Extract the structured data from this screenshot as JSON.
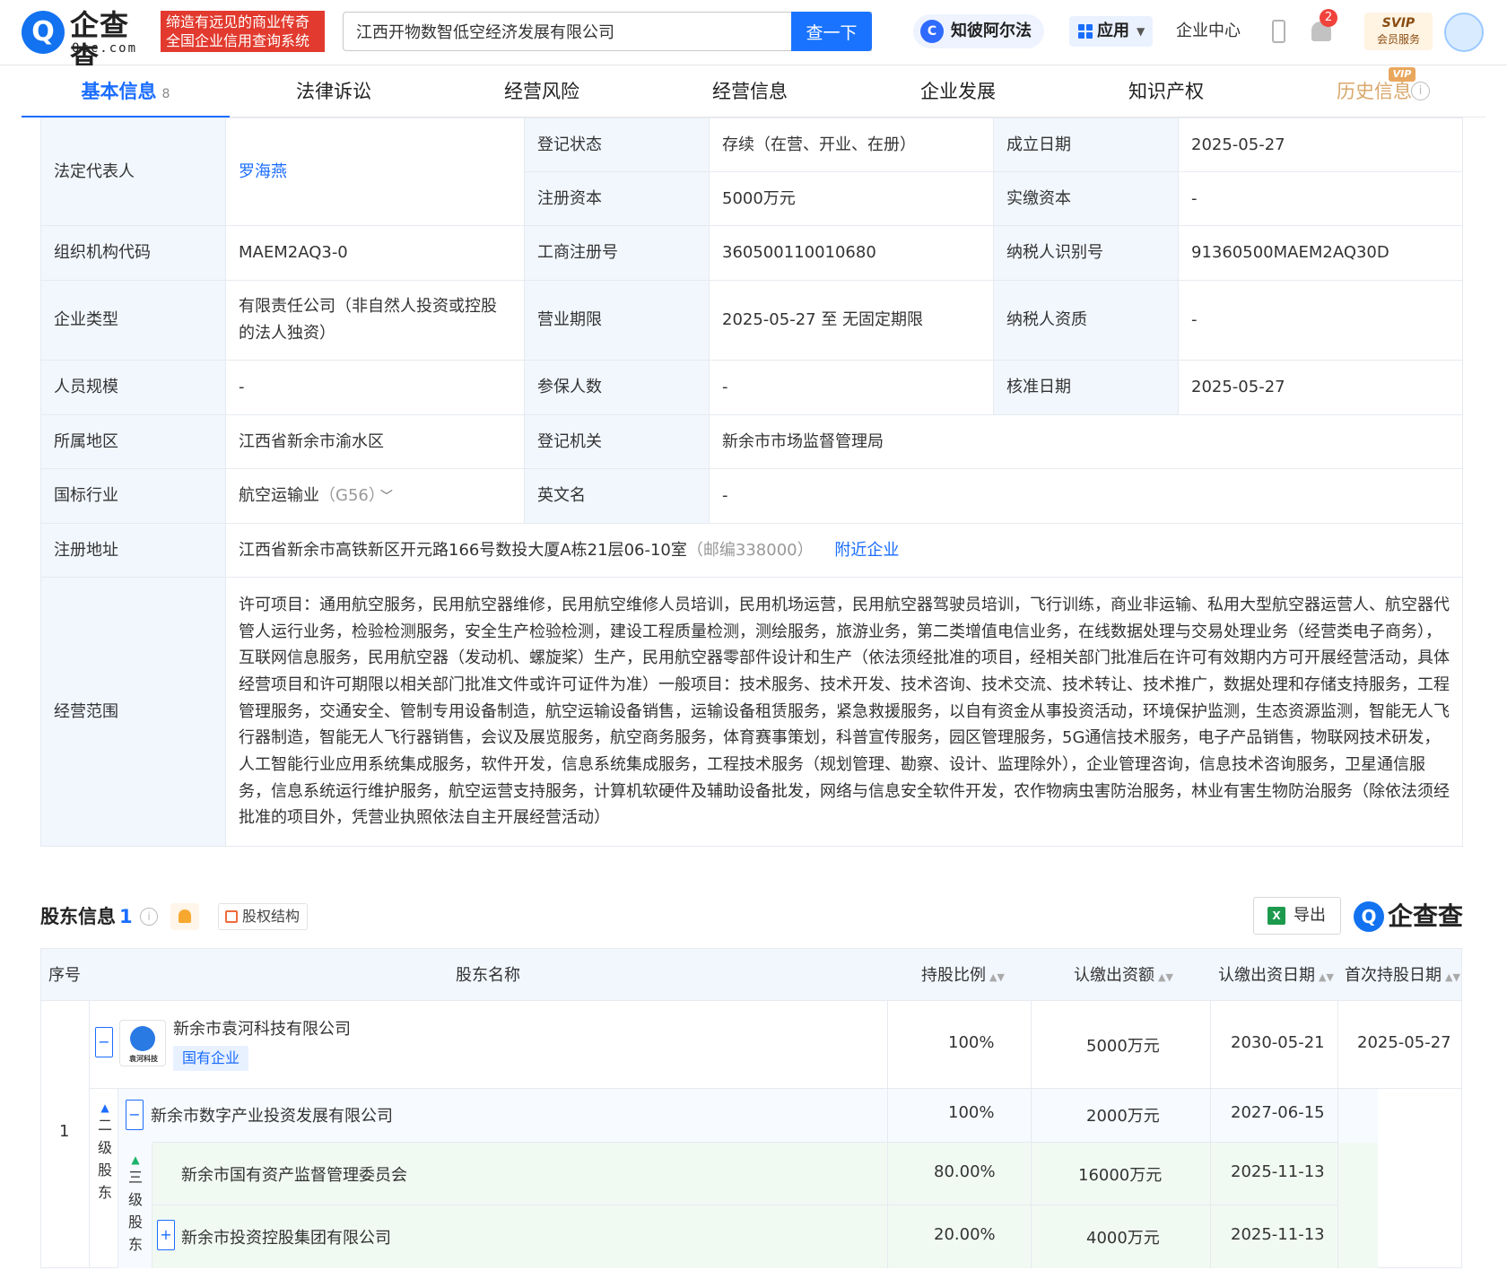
{
  "header": {
    "logo_cn": "企查查",
    "logo_en": "Qcc.com",
    "slogan_line1": "缔造有远见的商业传奇",
    "slogan_line2": "全国企业信用查询系统",
    "search_value": "江西开物数智低空经济发展有限公司",
    "search_button": "查一下",
    "ai_label": "知彼阿尔法",
    "apps_label": "应用",
    "enterprise_center": "企业中心",
    "notification_count": "2",
    "svip_top": "SVIP",
    "svip_bottom": "会员服务"
  },
  "tabs": [
    {
      "label": "基本信息",
      "count": "8"
    },
    {
      "label": "法律诉讼"
    },
    {
      "label": "经营风险"
    },
    {
      "label": "经营信息"
    },
    {
      "label": "企业发展"
    },
    {
      "label": "知识产权"
    },
    {
      "label": "历史信息",
      "tag": "VIP"
    }
  ],
  "info": {
    "legal_rep_label": "法定代表人",
    "legal_rep": "罗海燕",
    "reg_status_label": "登记状态",
    "reg_status": "存续（在营、开业、在册）",
    "found_date_label": "成立日期",
    "found_date": "2025-05-27",
    "reg_capital_label": "注册资本",
    "reg_capital": "5000万元",
    "paid_capital_label": "实缴资本",
    "paid_capital": "-",
    "org_code_label": "组织机构代码",
    "org_code": "MAEM2AQ3-0",
    "biz_reg_no_label": "工商注册号",
    "biz_reg_no": "360500110010680",
    "taxpayer_id_label": "纳税人识别号",
    "taxpayer_id": "91360500MAEM2AQ30D",
    "company_type_label": "企业类型",
    "company_type": "有限责任公司（非自然人投资或控股的法人独资）",
    "biz_term_label": "营业期限",
    "biz_term": "2025-05-27 至 无固定期限",
    "taxpayer_qual_label": "纳税人资质",
    "taxpayer_qual": "-",
    "staff_size_label": "人员规模",
    "staff_size": "-",
    "insured_label": "参保人数",
    "insured": "-",
    "approve_date_label": "核准日期",
    "approve_date": "2025-05-27",
    "region_label": "所属地区",
    "region": "江西省新余市渝水区",
    "reg_authority_label": "登记机关",
    "reg_authority": "新余市市场监督管理局",
    "industry_label": "国标行业",
    "industry": "航空运输业",
    "industry_code": "（G56）",
    "english_name_label": "英文名",
    "english_name": "-",
    "address_label": "注册地址",
    "address": "江西省新余市高铁新区开元路166号数投大厦A栋21层06-10室",
    "postcode": "（邮编338000）",
    "nearby_link": "附近企业",
    "scope_label": "经营范围",
    "scope": "许可项目：通用航空服务，民用航空器维修，民用航空维修人员培训，民用机场运营，民用航空器驾驶员培训，飞行训练，商业非运输、私用大型航空器运营人、航空器代管人运行业务，检验检测服务，安全生产检验检测，建设工程质量检测，测绘服务，旅游业务，第二类增值电信业务，在线数据处理与交易处理业务（经营类电子商务），互联网信息服务，民用航空器（发动机、螺旋桨）生产，民用航空器零部件设计和生产（依法须经批准的项目，经相关部门批准后在许可有效期内方可开展经营活动，具体经营项目和许可期限以相关部门批准文件或许可证件为准）一般项目：技术服务、技术开发、技术咨询、技术交流、技术转让、技术推广，数据处理和存储支持服务，工程管理服务，交通安全、管制专用设备制造，航空运输设备销售，运输设备租赁服务，紧急救援服务，以自有资金从事投资活动，环境保护监测，生态资源监测，智能无人飞行器制造，智能无人飞行器销售，会议及展览服务，航空商务服务，体育赛事策划，科普宣传服务，园区管理服务，5G通信技术服务，电子产品销售，物联网技术研发，人工智能行业应用系统集成服务，软件开发，信息系统集成服务，工程技术服务（规划管理、勘察、设计、监理除外），企业管理咨询，信息技术咨询服务，卫星通信服务，信息系统运行维护服务，航空运营支持服务，计算机软硬件及辅助设备批发，网络与信息安全软件开发，农作物病虫害防治服务，林业有害生物防治服务（除依法须经批准的项目外，凭营业执照依法自主开展经营活动）"
  },
  "shareholders": {
    "title": "股东信息",
    "count": "1",
    "structure_button": "股权结构",
    "export_button": "导出",
    "brand": "企查查",
    "columns": [
      "序号",
      "股东名称",
      "持股比例",
      "认缴出资额",
      "认缴出资日期",
      "首次持股日期"
    ],
    "rows": [
      {
        "index": "1",
        "name": "新余市袁河科技有限公司",
        "logo_text": "袁河科技",
        "tag": "国有企业",
        "ratio": "100%",
        "amount": "5000万元",
        "sub_date": "2030-05-21",
        "first_date": "2025-05-27",
        "level2_label": "二级股东",
        "level2": {
          "name": "新余市数字产业投资发展有限公司",
          "ratio": "100%",
          "amount": "2000万元",
          "sub_date": "2027-06-15"
        },
        "level3_label": "三级股东",
        "level3": [
          {
            "name": "新余市国有资产监督管理委员会",
            "ratio": "80.00%",
            "amount": "16000万元",
            "sub_date": "2025-11-13"
          },
          {
            "name": "新余市投资控股集团有限公司",
            "ratio": "20.00%",
            "amount": "4000万元",
            "sub_date": "2025-11-13"
          }
        ]
      }
    ]
  },
  "colors": {
    "brand_blue": "#1a6dff",
    "slogan_red": "#e23a2e",
    "label_bg": "#f2f7fe",
    "level3_bg": "#f1f9f3"
  }
}
